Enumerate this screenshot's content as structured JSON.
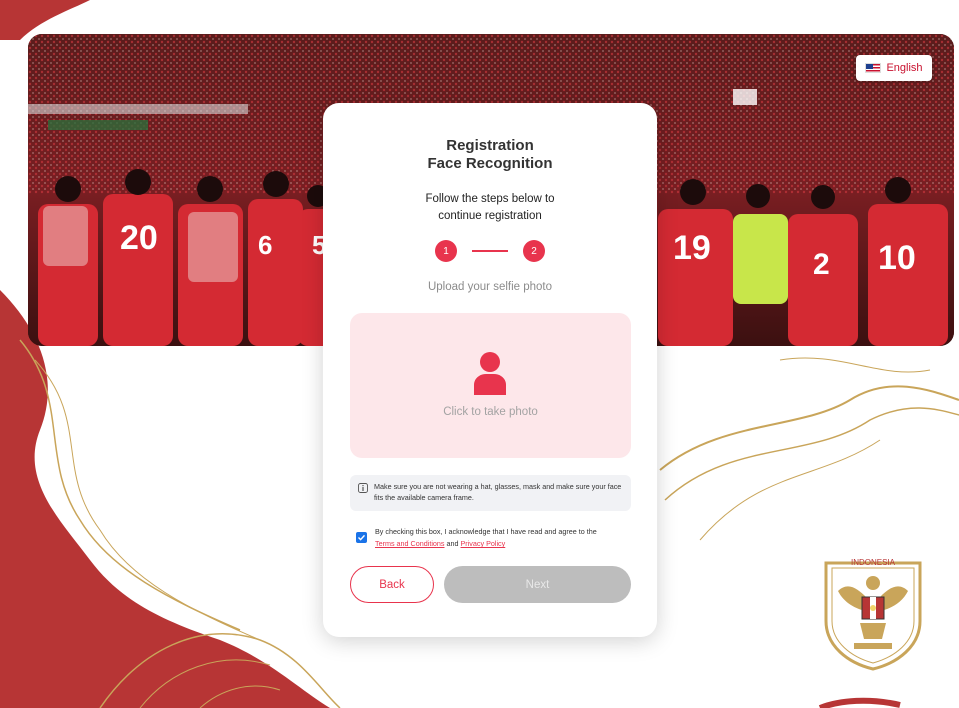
{
  "header": {
    "language_label": "English",
    "language_icon": "us-flag-icon"
  },
  "card": {
    "title_line1": "Registration",
    "title_line2": "Face Recognition",
    "subtitle_line1": "Follow the steps below to",
    "subtitle_line2": "continue registration",
    "steps": [
      {
        "label": "1"
      },
      {
        "label": "2"
      }
    ],
    "step_caption": "Upload your selfie photo",
    "photo_icon": "person-icon",
    "photo_prompt": "Click to take photo",
    "note": "Make sure you are not wearing a hat, glasses, mask and make sure your face fits the available camera frame.",
    "consent_text": "By checking this box, I acknowledge that I have read and agree to the",
    "consent_terms_link": "Terms and Conditions",
    "consent_and": "and",
    "consent_privacy_link": "Privacy Policy",
    "consent_checked": true,
    "back_label": "Back",
    "next_label": "Next"
  },
  "emblem": {
    "text": "INDONESIA"
  },
  "colors": {
    "brand_red": "#e8344d",
    "deco_red": "#b73535",
    "gold": "#c9a55a",
    "disabled_gray": "#bdbdbd"
  }
}
